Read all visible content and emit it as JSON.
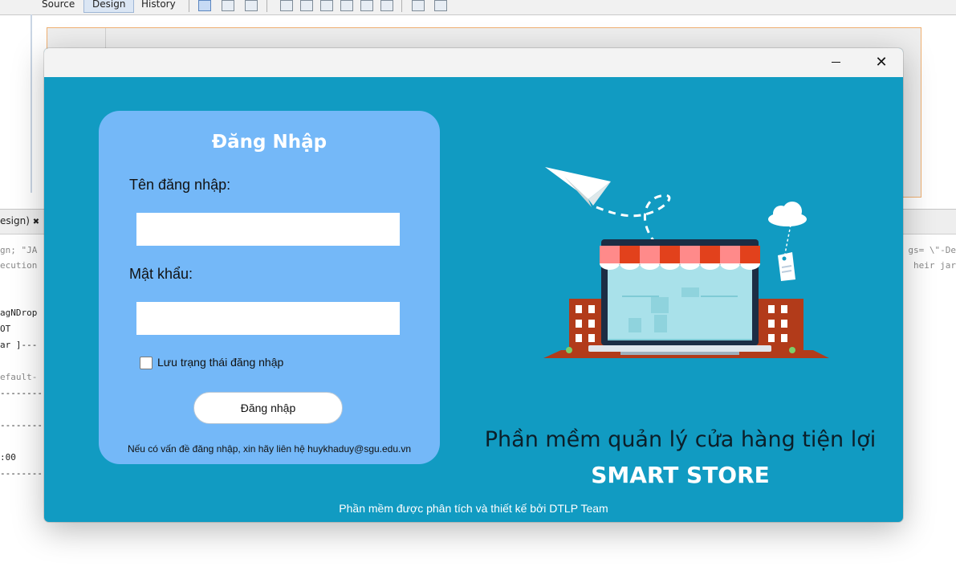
{
  "ide": {
    "tabs": [
      "Source",
      "Design",
      "History"
    ],
    "output_tab_label": "esign)",
    "output_tab_close": "✖",
    "console_left": [
      "gn; \"JA",
      "ecution",
      "",
      "agNDrop",
      "OT",
      "ar ]---",
      "",
      "efault-",
      "--------",
      "",
      "--------",
      "",
      ":00",
      "--------"
    ],
    "console_right": [
      "gs= \\\"-De",
      "heir jar"
    ]
  },
  "window": {
    "minimize_label": "–",
    "close_label": "✕"
  },
  "login": {
    "title": "Đăng Nhập",
    "username_label": "Tên đăng nhập:",
    "username_value": "",
    "password_label": "Mật khẩu:",
    "password_value": "",
    "remember_label": "Lưu trạng thái đăng nhập",
    "remember_checked": false,
    "button_label": "Đăng nhập",
    "contact_note": "Nếu có vấn đề đăng nhập, xin hãy liên hệ huykhaduy@sgu.edu.vn"
  },
  "branding": {
    "subtitle": "Phần mềm quản lý cửa hàng tiện lợi",
    "app_name": "SMART STORE",
    "footer": "Phần mềm được phân tích và thiết kế bởi DTLP Team"
  },
  "colors": {
    "window_bg": "#119bc2",
    "login_panel_bg": "#74b8f8",
    "awning_red": "#e2411c",
    "awning_pink": "#ff8a8a",
    "laptop_frame": "#1c2d44",
    "building_brick": "#b23b1a"
  },
  "icons": [
    "paper-plane-icon",
    "cloud-icon",
    "price-tag-icon",
    "laptop-store-icon",
    "minimize-icon",
    "close-icon"
  ]
}
